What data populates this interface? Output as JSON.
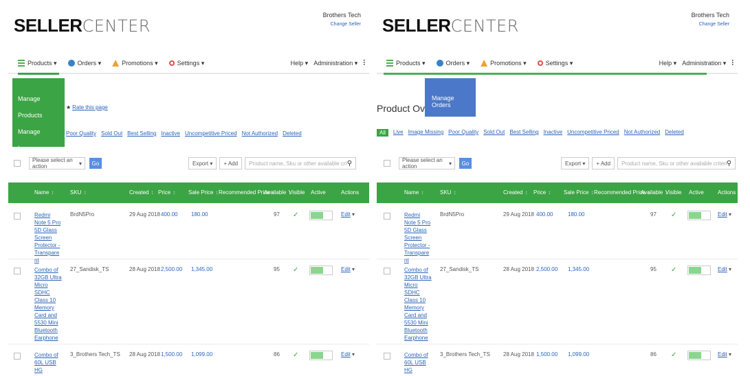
{
  "brand": {
    "strong": "SELLER",
    "light": "CENTER"
  },
  "account": {
    "name": "Brothers Tech",
    "change": "Change Seller"
  },
  "nav": {
    "products": "Products",
    "orders": "Orders",
    "promotions": "Promotions",
    "settings": "Settings",
    "help": "Help",
    "administration": "Administration"
  },
  "left": {
    "dropdown": [
      "Manage Products",
      "Manage Images"
    ],
    "favorite": "Rate this page",
    "filters": [
      "Poor Quality",
      "Sold Out",
      "Best Selling",
      "Inactive",
      "Uncompetitive Priced",
      "Not Authorized",
      "Deleted"
    ]
  },
  "right": {
    "dropdown": "Manage Orders",
    "title": "Product Overview",
    "filters": [
      "All",
      "Live",
      "Image Missing",
      "Poor Quality",
      "Sold Out",
      "Best Selling",
      "Inactive",
      "Uncompetitive Priced",
      "Not Authorized",
      "Deleted"
    ]
  },
  "toolbar": {
    "action_placeholder": "Please select an action",
    "go": "Go",
    "export": "Export",
    "add": "+ Add",
    "search_placeholder": "Product name, Sku or other available criteria"
  },
  "columns": [
    "Name",
    "SKU",
    "Created",
    "Price",
    "Sale Price",
    "Recommended Price",
    "Available",
    "Visible",
    "Active",
    "Actions"
  ],
  "rows": [
    {
      "name": "Redmi Note 5 Pro 5D Glass Screen Protector - Transparent",
      "sku": "BrdN5Pro",
      "created": "29 Aug 2018",
      "price": "400.00",
      "sale": "180.00",
      "available": "97",
      "visible": "✓",
      "action": "Edit"
    },
    {
      "name": "Combo of 32GB Ultra Micro SDHC Class 10 Memory Card and 5530 Mini Bluetooth Earphone",
      "sku": "27_Sandisk_TS",
      "created": "28 Aug 2018",
      "price": "2,500.00",
      "sale": "1,345.00",
      "available": "95",
      "visible": "✓",
      "action": "Edit"
    },
    {
      "name": "Combo of 60L USB HG",
      "sku": "3_Brothers Tech_TS",
      "created": "28 Aug 2018",
      "price": "1,500.00",
      "sale": "1,099.00",
      "available": "86",
      "visible": "✓",
      "action": "Edit"
    }
  ]
}
